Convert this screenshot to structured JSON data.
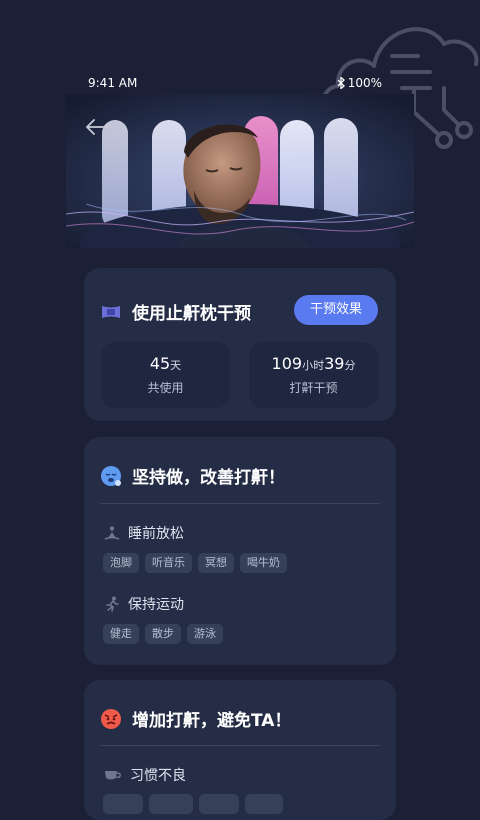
{
  "status_bar": {
    "time": "9:41 AM",
    "battery": "100%"
  },
  "plan": {
    "title": "使用止鼾枕干预",
    "effect_button": "干预效果",
    "stats": [
      {
        "value": "45",
        "unit": "天",
        "label": "共使用"
      },
      {
        "value": "109",
        "unit": "小时",
        "value2": "39",
        "unit2": "分",
        "label": "打鼾干预"
      }
    ]
  },
  "improve": {
    "title": "坚持做，改善打鼾！",
    "sections": [
      {
        "title": "睡前放松",
        "icon": "meditation-icon",
        "tags": [
          "泡脚",
          "听音乐",
          "冥想",
          "喝牛奶"
        ]
      },
      {
        "title": "保持运动",
        "icon": "running-icon",
        "tags": [
          "健走",
          "散步",
          "游泳"
        ]
      }
    ]
  },
  "avoid": {
    "title": "增加打鼾，避免TA！",
    "sections": [
      {
        "title": "习惯不良",
        "icon": "cup-icon",
        "tags": [
          "",
          "",
          "",
          ""
        ]
      }
    ]
  },
  "colors": {
    "background": "#1b2037",
    "card": "#252c45",
    "accent": "#5a7af0"
  }
}
